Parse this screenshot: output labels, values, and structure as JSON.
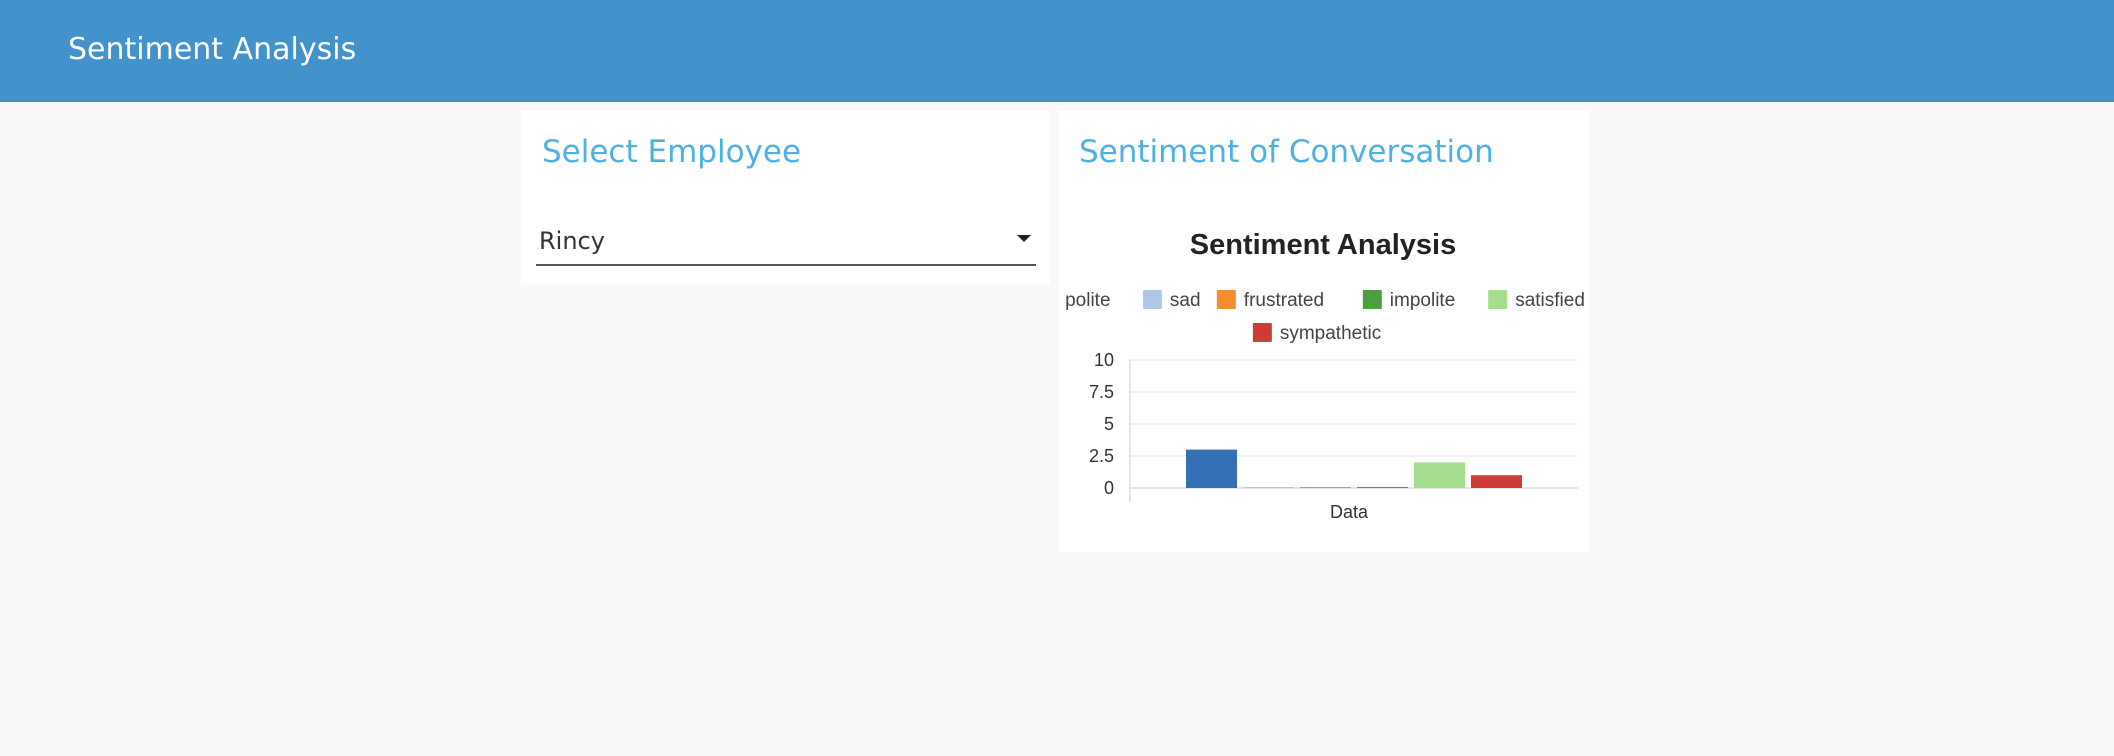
{
  "header": {
    "title": "Sentiment Analysis"
  },
  "employee_card": {
    "title": "Select Employee",
    "selected_employee": "Rincy"
  },
  "sentiment_card": {
    "title": "Sentiment of Conversation"
  },
  "colors": {
    "header_bg": "#4292cb",
    "card_title": "#4fb0e4",
    "page_bg": "#f8f8f8"
  },
  "icons": {
    "select_caret": "caret-down-icon"
  },
  "chart_data": {
    "type": "bar",
    "title": "Sentiment Analysis",
    "categories": [
      "Data"
    ],
    "series": [
      {
        "name": "polite",
        "values": [
          3
        ],
        "color": "#3470b4"
      },
      {
        "name": "sad",
        "values": [
          0
        ],
        "color": "#aec7e8"
      },
      {
        "name": "frustrated",
        "values": [
          0
        ],
        "color": "#f28e2b"
      },
      {
        "name": "impolite",
        "values": [
          0
        ],
        "color": "#4c9e3f"
      },
      {
        "name": "satisfied",
        "values": [
          2
        ],
        "color": "#a5de8f"
      },
      {
        "name": "sympathetic",
        "values": [
          1
        ],
        "color": "#cf3b35"
      }
    ],
    "yticks": [
      "0",
      "2.5",
      "5",
      "7.5",
      "10"
    ],
    "ylim": [
      0,
      10
    ],
    "xlabel": "",
    "ylabel": "",
    "legend_position": "top",
    "grid": true
  }
}
